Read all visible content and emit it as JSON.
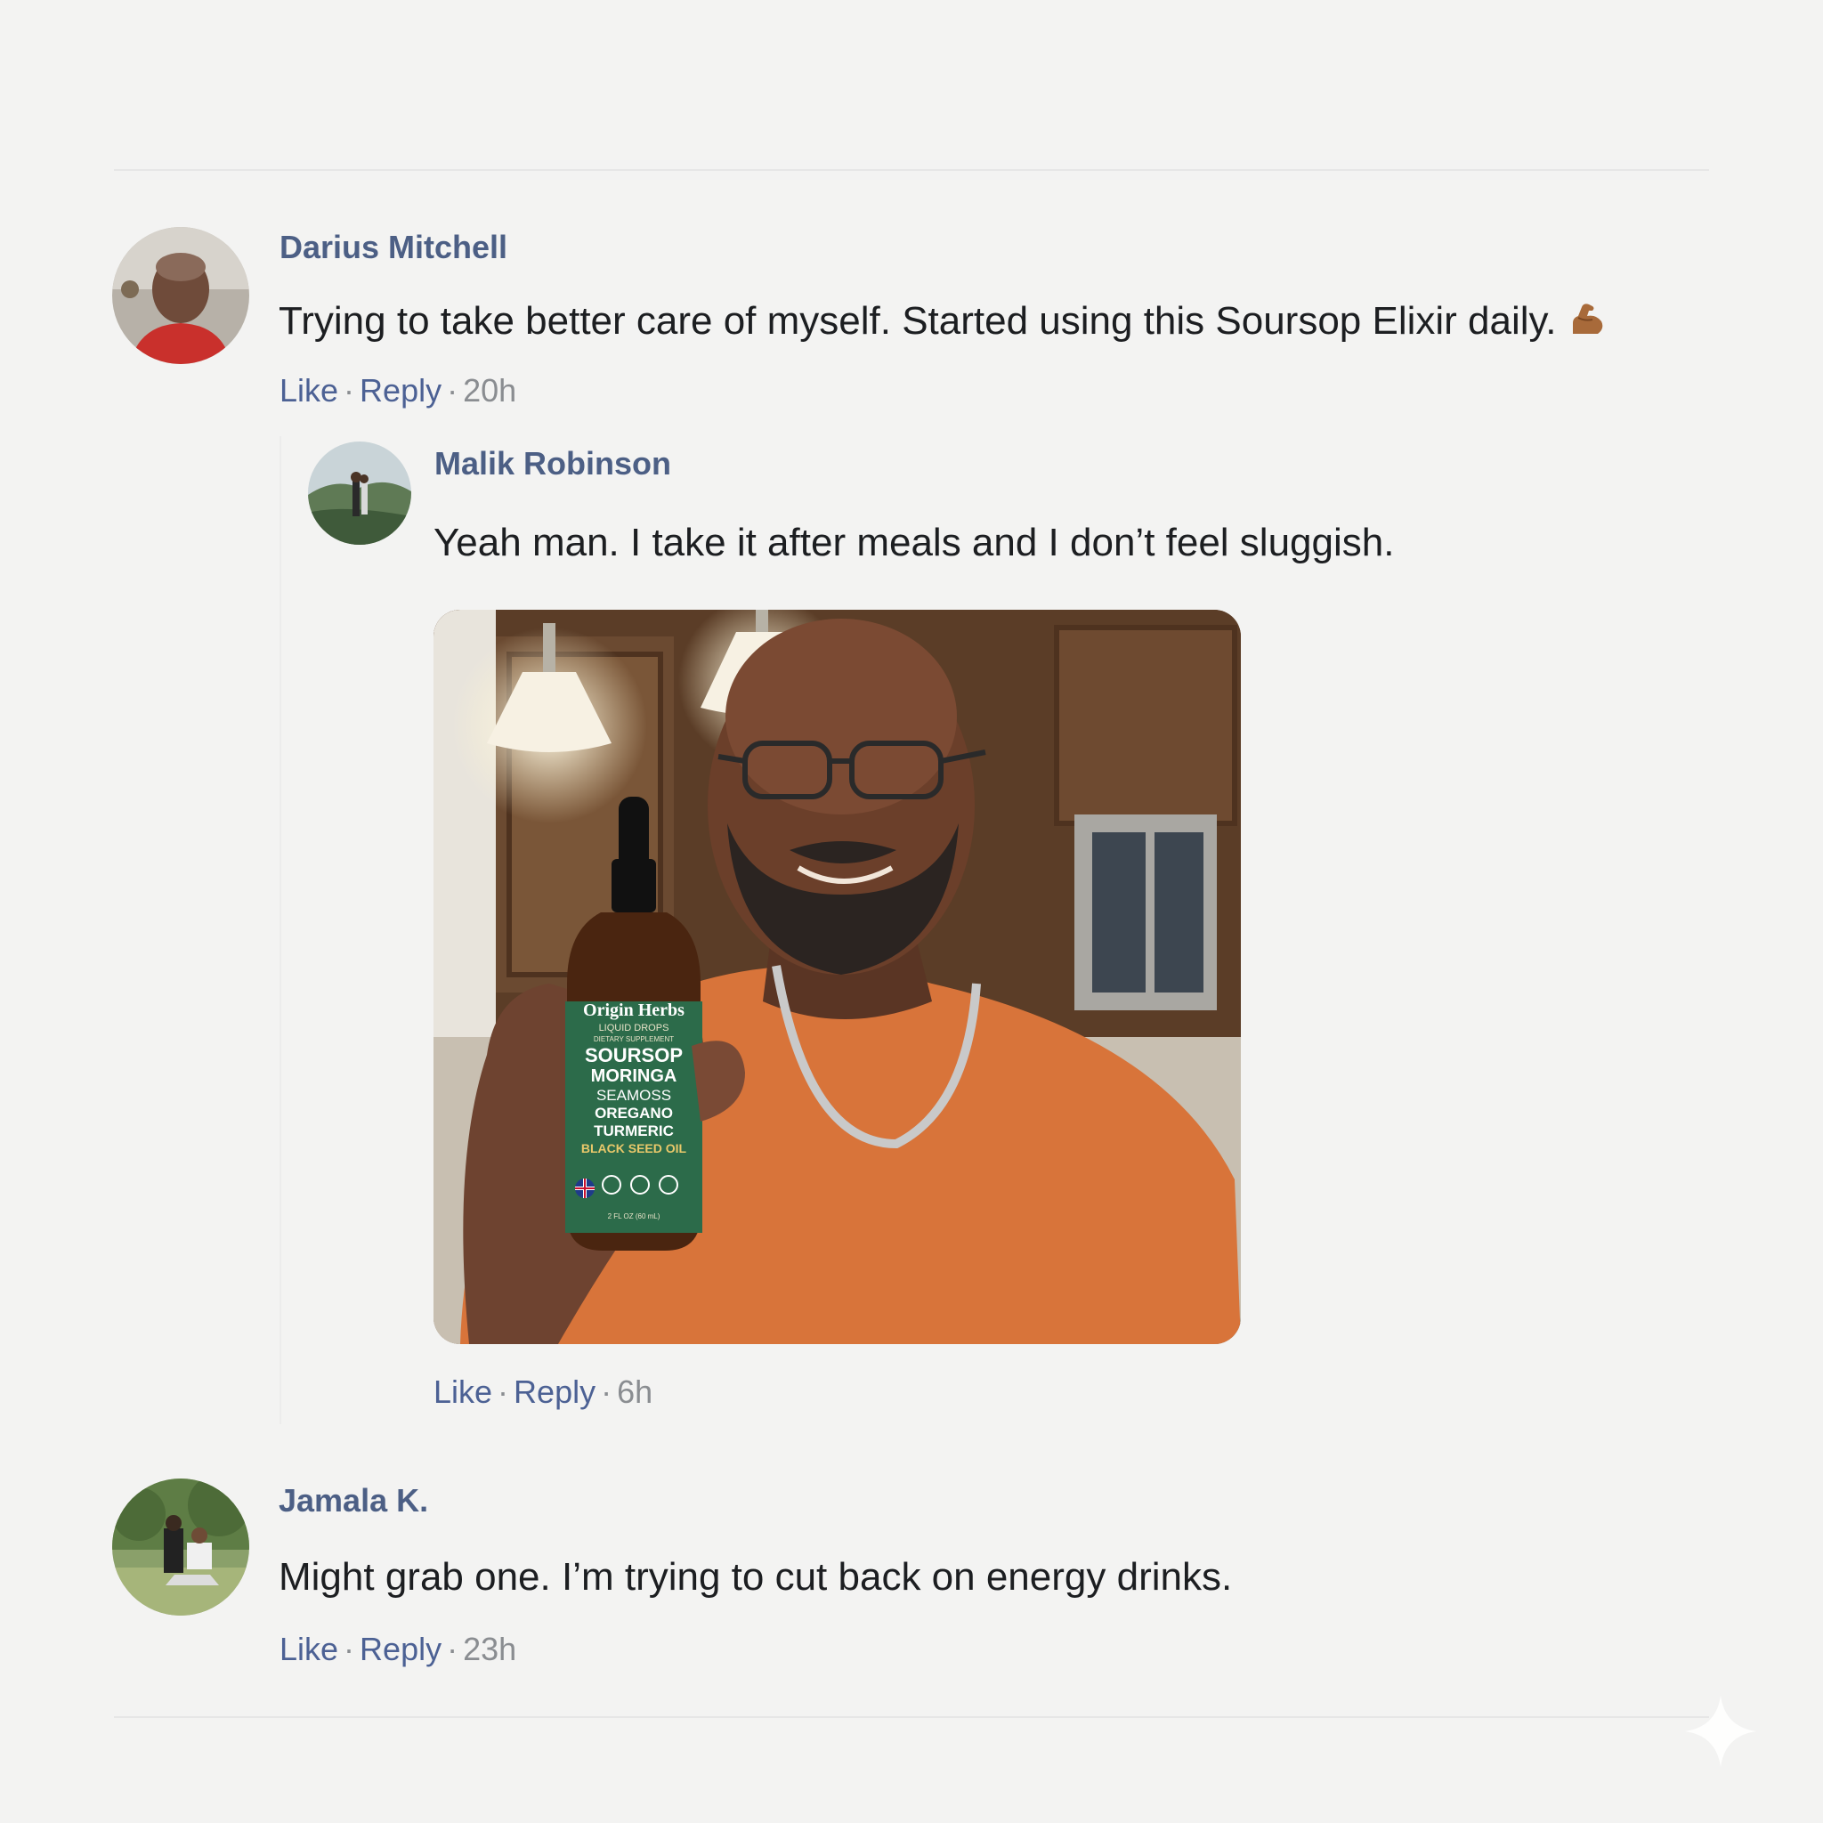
{
  "comments": [
    {
      "author": "Darius Mitchell",
      "text": "Trying to take better care of myself. Started using this Soursop Elixir daily.",
      "emoji": "flexed-biceps",
      "like_label": "Like",
      "reply_label": "Reply",
      "separator": "·",
      "time": "20h",
      "replies": [
        {
          "author": "Malik Robinson",
          "text": "Yeah man. I take it after meals and I don’t feel sluggish.",
          "like_label": "Like",
          "reply_label": "Reply",
          "separator": "·",
          "time": "6h",
          "photo": {
            "description_icon": "man-holding-bottle-photo",
            "bottle_label": {
              "brand": "Origin Herbs",
              "line1": "LIQUID DROPS",
              "line2": "DIETARY SUPPLEMENT",
              "ingredients": [
                "SOURSOP",
                "MORINGA",
                "SEAMOSS",
                "OREGANO",
                "TURMERIC"
              ],
              "highlight": "BLACK SEED OIL",
              "footer": "2 FL OZ (60 mL)"
            }
          }
        }
      ]
    },
    {
      "author": "Jamala K.",
      "text": "Might grab one. I’m trying to cut back on energy drinks.",
      "like_label": "Like",
      "reply_label": "Reply",
      "separator": "·",
      "time": "23h"
    }
  ],
  "colors": {
    "background": "#f3f3f2",
    "author": "#4c5f85",
    "link": "#4c6194",
    "body_text": "#1c1e21",
    "meta": "#8a8d91"
  }
}
